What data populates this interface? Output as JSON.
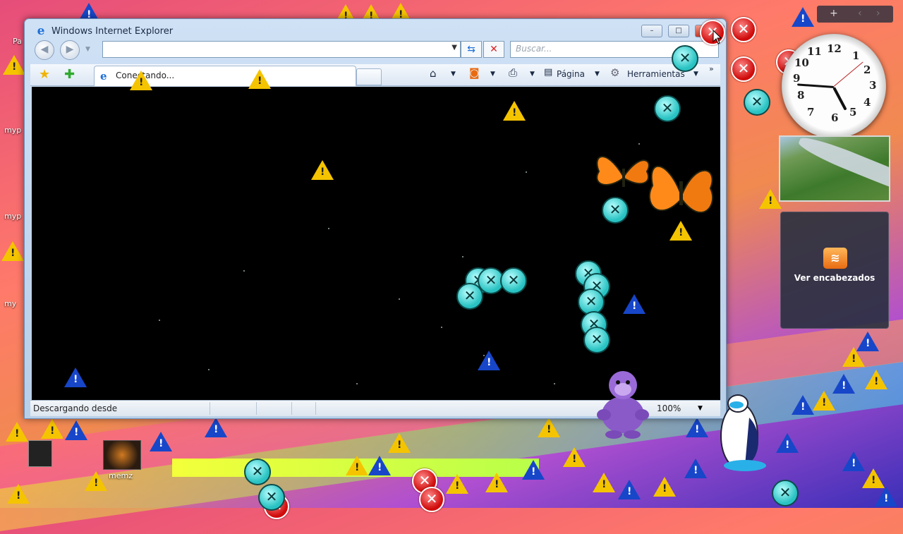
{
  "window": {
    "title": "Windows Internet Explorer",
    "minimize": "–",
    "maximize": "□",
    "close": "✕"
  },
  "nav": {
    "back_icon": "back-arrow-icon",
    "forward_icon": "forward-arrow-icon",
    "address_value": "",
    "refresh_glyph": "⇆",
    "stop_glyph": "✕",
    "search_placeholder": "Buscar..."
  },
  "tabs": [
    {
      "label": "Conectando..."
    }
  ],
  "commands": {
    "home": "⌂",
    "feeds": "◙",
    "print": "⎙",
    "page": "Página",
    "tools": "Herramientas",
    "more": "»"
  },
  "status": {
    "text": "Descargando desde",
    "zoom": "100%"
  },
  "gadgets": {
    "clock_numbers": [
      "12",
      "1",
      "2",
      "3",
      "4",
      "5",
      "6",
      "7",
      "8",
      "9",
      "10",
      "11"
    ],
    "feed_label": "Ver encabezados",
    "topbar_add": "+"
  },
  "desktop_icons": [
    {
      "label": "memz"
    },
    {
      "label": "myp"
    },
    {
      "label": "myp"
    },
    {
      "label": "my"
    },
    {
      "label": "Pa"
    }
  ],
  "colors": {
    "warning_yellow": "#f5c400",
    "warning_blue": "#1746c9",
    "error_red": "#d00c0c",
    "error_cyan": "#29c2c2"
  }
}
